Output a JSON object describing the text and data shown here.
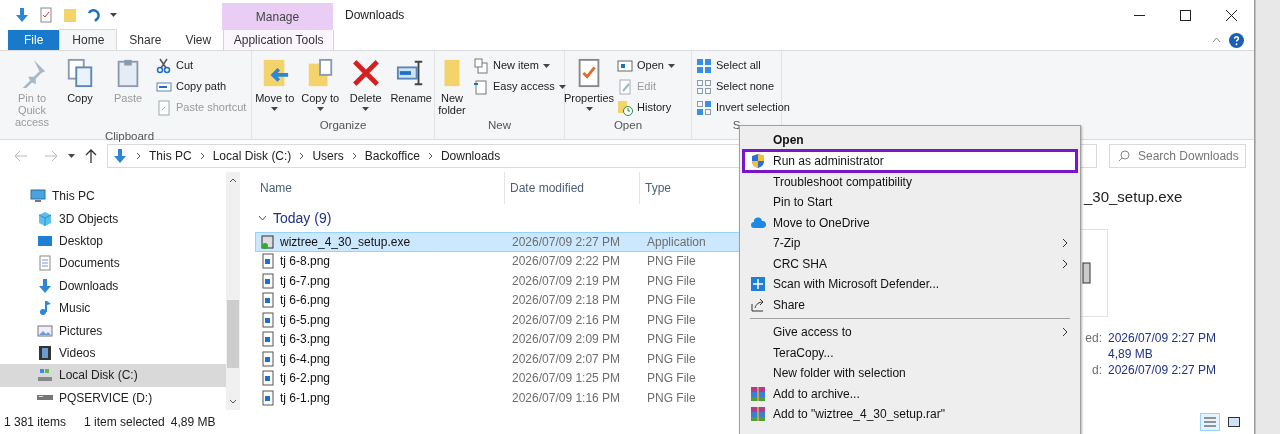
{
  "title_bar": {
    "context_tab": "Manage",
    "title": "Downloads"
  },
  "ribbon_tabs": [
    {
      "label": "File",
      "kind": "file",
      "selected": false
    },
    {
      "label": "Home",
      "kind": "tab",
      "selected": true
    },
    {
      "label": "Share",
      "kind": "tab",
      "selected": false
    },
    {
      "label": "View",
      "kind": "tab",
      "selected": false
    },
    {
      "label": "Application Tools",
      "kind": "context",
      "selected": false
    }
  ],
  "ribbon_groups": [
    {
      "name": "Clipboard",
      "items": [
        {
          "label": "Pin to Quick access",
          "kind": "large",
          "disabled": true,
          "dropdown": false
        },
        {
          "label": "Copy",
          "kind": "large",
          "disabled": false,
          "dropdown": false
        },
        {
          "label": "Paste",
          "kind": "large",
          "disabled": true,
          "dropdown": false
        },
        {
          "label": "Cut",
          "kind": "small",
          "disabled": false,
          "dropdown": false
        },
        {
          "label": "Copy path",
          "kind": "small",
          "disabled": false,
          "dropdown": false
        },
        {
          "label": "Paste shortcut",
          "kind": "small",
          "disabled": true,
          "dropdown": false
        }
      ]
    },
    {
      "name": "Organize",
      "items": [
        {
          "label": "Move to",
          "kind": "large",
          "disabled": false,
          "dropdown": true
        },
        {
          "label": "Copy to",
          "kind": "large",
          "disabled": false,
          "dropdown": true
        },
        {
          "label": "Delete",
          "kind": "large",
          "disabled": false,
          "dropdown": true
        },
        {
          "label": "Rename",
          "kind": "large",
          "disabled": false,
          "dropdown": false
        }
      ]
    },
    {
      "name": "New",
      "items": [
        {
          "label": "New folder",
          "kind": "large",
          "disabled": false,
          "dropdown": false
        },
        {
          "label": "New item",
          "kind": "small",
          "disabled": false,
          "dropdown": true
        },
        {
          "label": "Easy access",
          "kind": "small",
          "disabled": false,
          "dropdown": true
        }
      ]
    },
    {
      "name": "Open",
      "items": [
        {
          "label": "Properties",
          "kind": "large",
          "disabled": false,
          "dropdown": true
        },
        {
          "label": "Open",
          "kind": "small",
          "disabled": false,
          "dropdown": true
        },
        {
          "label": "Edit",
          "kind": "small",
          "disabled": true,
          "dropdown": false
        },
        {
          "label": "History",
          "kind": "small",
          "disabled": false,
          "dropdown": false
        }
      ]
    },
    {
      "name": "S",
      "items": [
        {
          "label": "Select all",
          "kind": "small",
          "disabled": false,
          "dropdown": false
        },
        {
          "label": "Select none",
          "kind": "small",
          "disabled": false,
          "dropdown": false
        },
        {
          "label": "Invert selection",
          "kind": "small",
          "disabled": false,
          "dropdown": false
        }
      ]
    }
  ],
  "address_bar": {
    "path": [
      "This PC",
      "Local Disk (C:)",
      "Users",
      "Backoffice",
      "Downloads"
    ]
  },
  "search": {
    "placeholder": "Search Downloads"
  },
  "navigation": [
    {
      "label": "This PC",
      "kind": "pc",
      "selected": false,
      "children": [
        {
          "label": "3D Objects",
          "kind": "objects",
          "selected": false
        },
        {
          "label": "Desktop",
          "kind": "desktop",
          "selected": false
        },
        {
          "label": "Documents",
          "kind": "documents",
          "selected": false
        },
        {
          "label": "Downloads",
          "kind": "downloads",
          "selected": false
        },
        {
          "label": "Music",
          "kind": "music",
          "selected": false
        },
        {
          "label": "Pictures",
          "kind": "pictures",
          "selected": false
        },
        {
          "label": "Videos",
          "kind": "videos",
          "selected": false
        },
        {
          "label": "Local Disk (C:)",
          "kind": "disk",
          "selected": true
        },
        {
          "label": "PQSERVICE (D:)",
          "kind": "drive",
          "selected": false
        }
      ]
    }
  ],
  "file_list": {
    "columns": [
      "Name",
      "Date modified",
      "Type"
    ],
    "group": {
      "label": "Today (9)",
      "expanded": true
    },
    "rows": [
      {
        "name": "wiztree_4_30_setup.exe",
        "date": "2026/07/09 2:27 PM",
        "type": "Application",
        "kind": "exe",
        "selected": true
      },
      {
        "name": "tj 6-8.png",
        "date": "2026/07/09 2:22 PM",
        "type": "PNG File",
        "kind": "png",
        "selected": false
      },
      {
        "name": "tj 6-7.png",
        "date": "2026/07/09 2:19 PM",
        "type": "PNG File",
        "kind": "png",
        "selected": false
      },
      {
        "name": "tj 6-6.png",
        "date": "2026/07/09 2:18 PM",
        "type": "PNG File",
        "kind": "png",
        "selected": false
      },
      {
        "name": "tj 6-5.png",
        "date": "2026/07/09 2:16 PM",
        "type": "PNG File",
        "kind": "png",
        "selected": false
      },
      {
        "name": "tj 6-3.png",
        "date": "2026/07/09 2:09 PM",
        "type": "PNG File",
        "kind": "png",
        "selected": false
      },
      {
        "name": "tj 6-4.png",
        "date": "2026/07/09 2:07 PM",
        "type": "PNG File",
        "kind": "png",
        "selected": false
      },
      {
        "name": "tj 6-2.png",
        "date": "2026/07/09 1:25 PM",
        "type": "PNG File",
        "kind": "png",
        "selected": false
      },
      {
        "name": "tj 6-1.png",
        "date": "2026/07/09 1:16 PM",
        "type": "PNG File",
        "kind": "png",
        "selected": false
      }
    ]
  },
  "details_pane": {
    "file_name": "_30_setup.exe",
    "properties": [
      {
        "label": "ed:",
        "value": "2026/07/09 2:27 PM"
      },
      {
        "value": "4,89 MB"
      },
      {
        "label": "d:",
        "value": "2026/07/09 2:27 PM"
      }
    ]
  },
  "status_bar": {
    "item_count": "1 381 items",
    "selection": "1 item selected",
    "size": "4,89 MB"
  },
  "context_menu": [
    {
      "label": "Open",
      "kind": "item",
      "bold": true,
      "highlighted": false,
      "submenu": false
    },
    {
      "label": "Run as administrator",
      "kind": "item",
      "bold": false,
      "highlighted": true,
      "submenu": false
    },
    {
      "label": "Troubleshoot compatibility",
      "kind": "item",
      "bold": false,
      "highlighted": false,
      "submenu": false
    },
    {
      "label": "Pin to Start",
      "kind": "item",
      "bold": false,
      "highlighted": false,
      "submenu": false
    },
    {
      "label": "Move to OneDrive",
      "kind": "item",
      "bold": false,
      "highlighted": false,
      "submenu": false
    },
    {
      "label": "7-Zip",
      "kind": "item",
      "bold": false,
      "highlighted": false,
      "submenu": true
    },
    {
      "label": "CRC SHA",
      "kind": "item",
      "bold": false,
      "highlighted": false,
      "submenu": true
    },
    {
      "label": "Scan with Microsoft Defender...",
      "kind": "item",
      "bold": false,
      "highlighted": false,
      "submenu": false
    },
    {
      "label": "Share",
      "kind": "item",
      "bold": false,
      "highlighted": false,
      "submenu": false
    },
    {
      "kind": "separator"
    },
    {
      "label": "Give access to",
      "kind": "item",
      "bold": false,
      "highlighted": false,
      "submenu": true
    },
    {
      "label": "TeraCopy...",
      "kind": "item",
      "bold": false,
      "highlighted": false,
      "submenu": false
    },
    {
      "label": "New folder with selection",
      "kind": "item",
      "bold": false,
      "highlighted": false,
      "submenu": false
    },
    {
      "label": "Add to archive...",
      "kind": "item",
      "bold": false,
      "highlighted": false,
      "submenu": false
    },
    {
      "label": "Add to \"wiztree_4_30_setup.rar\"",
      "kind": "item",
      "bold": false,
      "highlighted": false,
      "submenu": false
    }
  ]
}
